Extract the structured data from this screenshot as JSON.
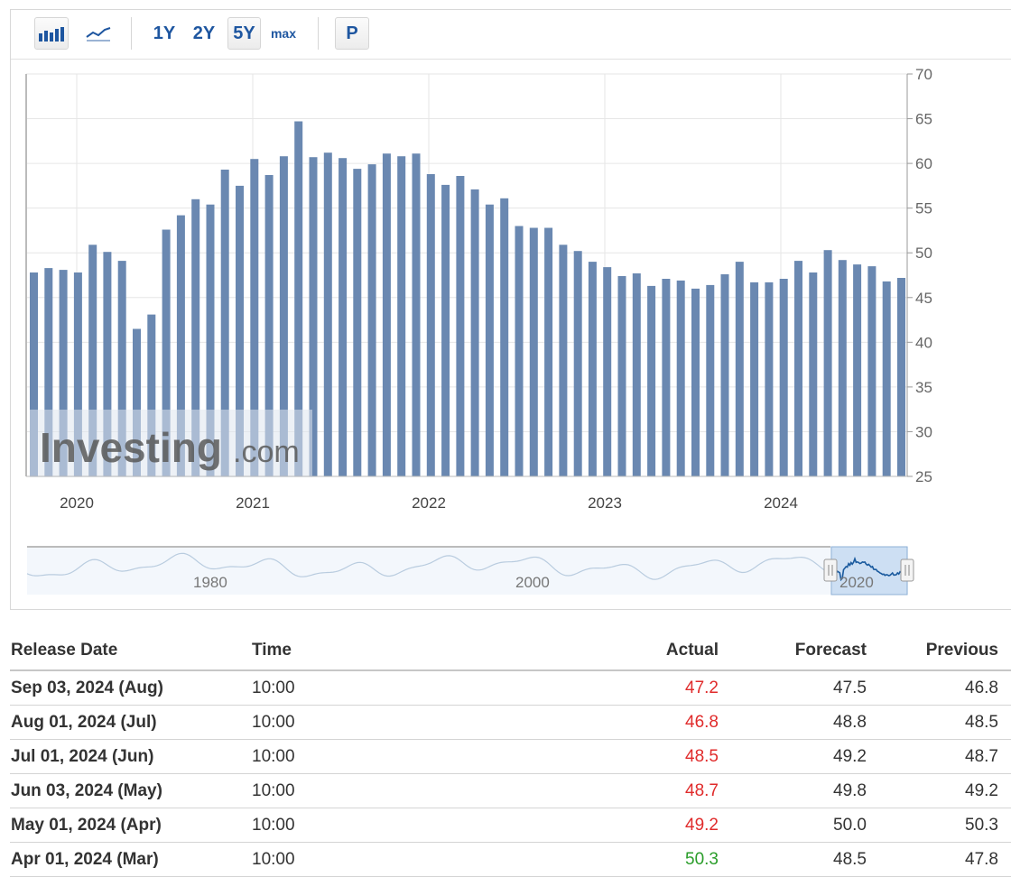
{
  "toolbar": {
    "range_buttons": [
      "1Y",
      "2Y",
      "5Y",
      "max"
    ],
    "active_range": "5Y",
    "print_label": "P",
    "icons": [
      "bar-chart-icon",
      "line-chart-icon"
    ]
  },
  "colors": {
    "bar": "#6a88b1",
    "negative": "#e02b2b",
    "positive": "#2a9d2a",
    "grid": "#e6e6e6",
    "navigator_line": "#1a5a9e"
  },
  "chart_data": {
    "type": "bar",
    "title": "",
    "xlabel": "",
    "ylabel": "",
    "ylim": [
      25,
      70
    ],
    "y_ticks": [
      25,
      30,
      35,
      40,
      45,
      50,
      55,
      60,
      65,
      70
    ],
    "x_tick_labels": [
      "2020",
      "2021",
      "2022",
      "2023",
      "2024"
    ],
    "grid": true,
    "y_axis_side": "right",
    "watermark": "Investing.com",
    "values": [
      47.8,
      48.3,
      48.1,
      47.8,
      50.9,
      50.1,
      49.1,
      41.5,
      43.1,
      52.6,
      54.2,
      56.0,
      55.4,
      59.3,
      57.5,
      60.5,
      58.7,
      60.8,
      64.7,
      60.7,
      61.2,
      60.6,
      59.4,
      59.9,
      61.1,
      60.8,
      61.1,
      58.8,
      57.6,
      58.6,
      57.1,
      55.4,
      56.1,
      53.0,
      52.8,
      52.8,
      50.9,
      50.2,
      49.0,
      48.4,
      47.4,
      47.7,
      46.3,
      47.1,
      46.9,
      46.0,
      46.4,
      47.6,
      49.0,
      46.7,
      46.7,
      47.1,
      49.1,
      47.8,
      50.3,
      49.2,
      48.7,
      48.5,
      46.8,
      47.2
    ],
    "navigator": {
      "tick_labels": [
        "1980",
        "2000",
        "2020"
      ]
    }
  },
  "table": {
    "headers": [
      "Release Date",
      "Time",
      "Actual",
      "Forecast",
      "Previous"
    ],
    "rows": [
      {
        "date": "Sep 03, 2024 (Aug)",
        "time": "10:00",
        "actual": "47.2",
        "actual_trend": "negative",
        "forecast": "47.5",
        "previous": "46.8"
      },
      {
        "date": "Aug 01, 2024 (Jul)",
        "time": "10:00",
        "actual": "46.8",
        "actual_trend": "negative",
        "forecast": "48.8",
        "previous": "48.5"
      },
      {
        "date": "Jul 01, 2024 (Jun)",
        "time": "10:00",
        "actual": "48.5",
        "actual_trend": "negative",
        "forecast": "49.2",
        "previous": "48.7"
      },
      {
        "date": "Jun 03, 2024 (May)",
        "time": "10:00",
        "actual": "48.7",
        "actual_trend": "negative",
        "forecast": "49.8",
        "previous": "49.2"
      },
      {
        "date": "May 01, 2024 (Apr)",
        "time": "10:00",
        "actual": "49.2",
        "actual_trend": "negative",
        "forecast": "50.0",
        "previous": "50.3"
      },
      {
        "date": "Apr 01, 2024 (Mar)",
        "time": "10:00",
        "actual": "50.3",
        "actual_trend": "positive",
        "forecast": "48.5",
        "previous": "47.8"
      }
    ]
  }
}
